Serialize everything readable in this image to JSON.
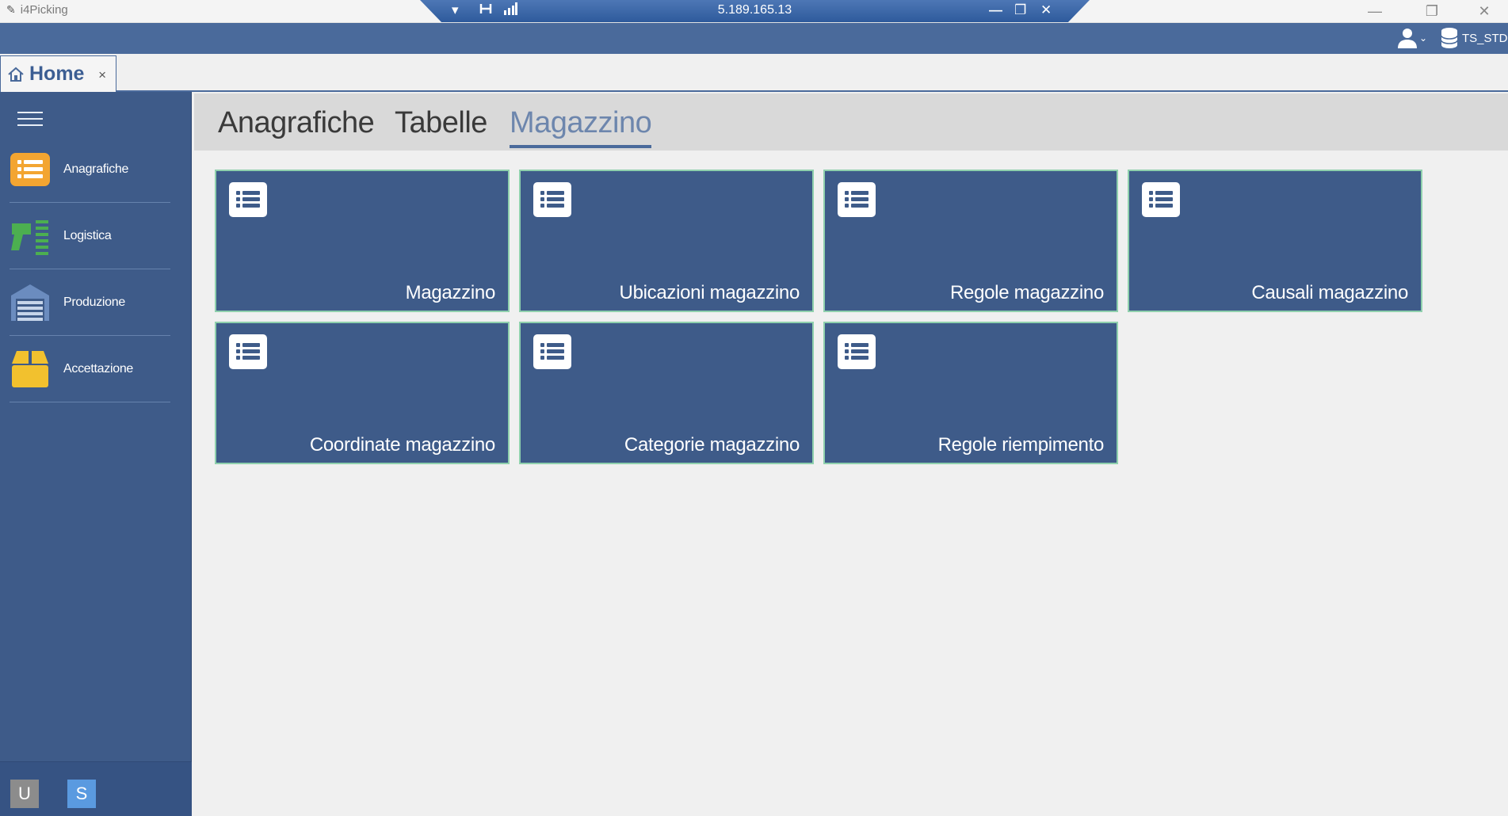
{
  "window": {
    "app_title": "i4Picking",
    "remote_host": "5.189.165.13"
  },
  "header": {
    "database_label": "TS_STD"
  },
  "tabs": {
    "home_label": "Home",
    "close_glyph": "×"
  },
  "sidebar": {
    "items": [
      {
        "label": "Anagrafiche",
        "icon": "list-icon"
      },
      {
        "label": "Logistica",
        "icon": "barcode-scanner-icon"
      },
      {
        "label": "Produzione",
        "icon": "warehouse-icon"
      },
      {
        "label": "Accettazione",
        "icon": "box-icon"
      }
    ],
    "footer": {
      "u_label": "U",
      "s_label": "S"
    }
  },
  "ribbon": {
    "tabs": [
      "Anagrafiche",
      "Tabelle",
      "Magazzino"
    ],
    "active_tab": "Magazzino"
  },
  "tiles": [
    {
      "label": "Magazzino",
      "icon": "list-icon"
    },
    {
      "label": "Ubicazioni magazzino",
      "icon": "list-icon"
    },
    {
      "label": "Regole magazzino",
      "icon": "list-icon"
    },
    {
      "label": "Causali magazzino",
      "icon": "list-icon"
    },
    {
      "label": "Coordinate magazzino",
      "icon": "list-icon"
    },
    {
      "label": "Categorie magazzino",
      "icon": "list-icon"
    },
    {
      "label": "Regole riempimento",
      "icon": "list-icon"
    }
  ],
  "colors": {
    "primary": "#3e5b89",
    "header": "#4a6a9b",
    "tile_border": "#8fd0ad",
    "accent_orange": "#f3a531",
    "accent_green": "#4caf50",
    "accent_yellow": "#f2c12e"
  }
}
